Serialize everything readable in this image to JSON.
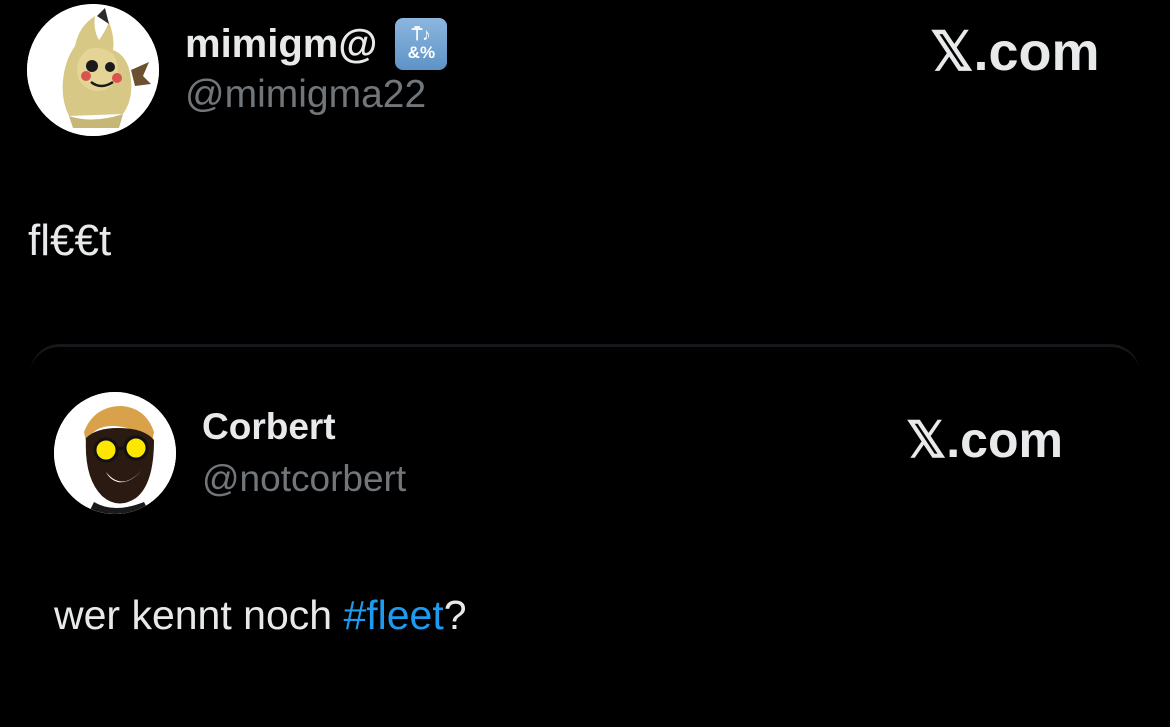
{
  "main_tweet": {
    "display_name": "mimigm@",
    "badge_icon": "input-symbols-emoji-icon",
    "badge_line1": "⍑♪",
    "badge_line2": "&%",
    "handle": "@mimigma22",
    "source_label": "𝕏.com",
    "text": "fl€€t",
    "avatar_icon": "mimikyu-avatar-icon"
  },
  "quoted_tweet": {
    "display_name": "Corbert",
    "handle": "@notcorbert",
    "source_label": "𝕏.com",
    "text_before": "wer kennt noch ",
    "hashtag": "#fleet",
    "text_after": "?",
    "avatar_icon": "smiling-man-sunglasses-avatar-icon"
  },
  "colors": {
    "background": "#000000",
    "text": "#e7e9ea",
    "muted": "#71767b",
    "hashtag": "#1d9bf0"
  }
}
